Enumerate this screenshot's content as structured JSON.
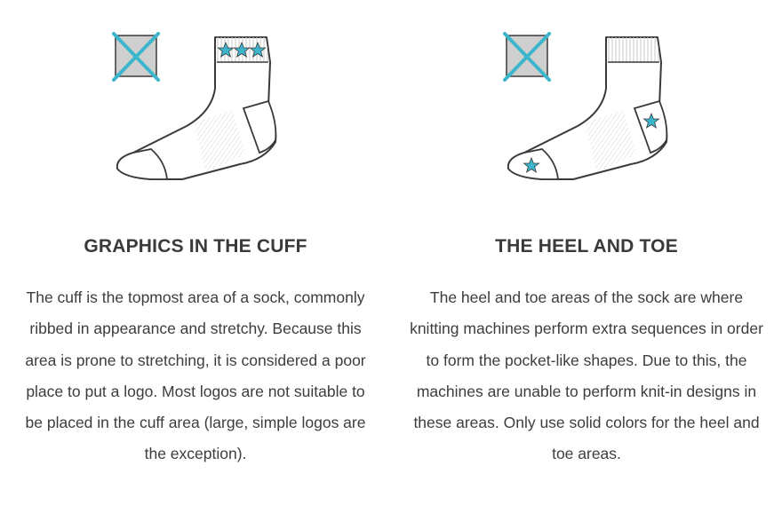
{
  "sections": [
    {
      "title": "GRAPHICS IN THE CUFF",
      "body": "The cuff is the topmost area of a sock, commonly ribbed in appearance and stretchy. Because this area is prone to stretching, it is considered a poor place to put a logo. Most logos are not suitable to be placed in the cuff area (large, simple logos are the exception).",
      "icon": "sock-cuff-stars-icon"
    },
    {
      "title": "THE HEEL AND TOE",
      "body": "The heel and toe areas of the sock are where knitting machines perform extra sequences in order to form the pocket-like shapes. Due to this, the machines are unable to perform knit-in designs in these areas. Only use solid colors for the heel and toe areas.",
      "icon": "sock-heel-toe-stars-icon"
    }
  ],
  "colors": {
    "accent": "#3bb6cc",
    "outline": "#3a3a3a",
    "crossed_box": "#c8c8c8",
    "text": "#3d3d3d"
  }
}
